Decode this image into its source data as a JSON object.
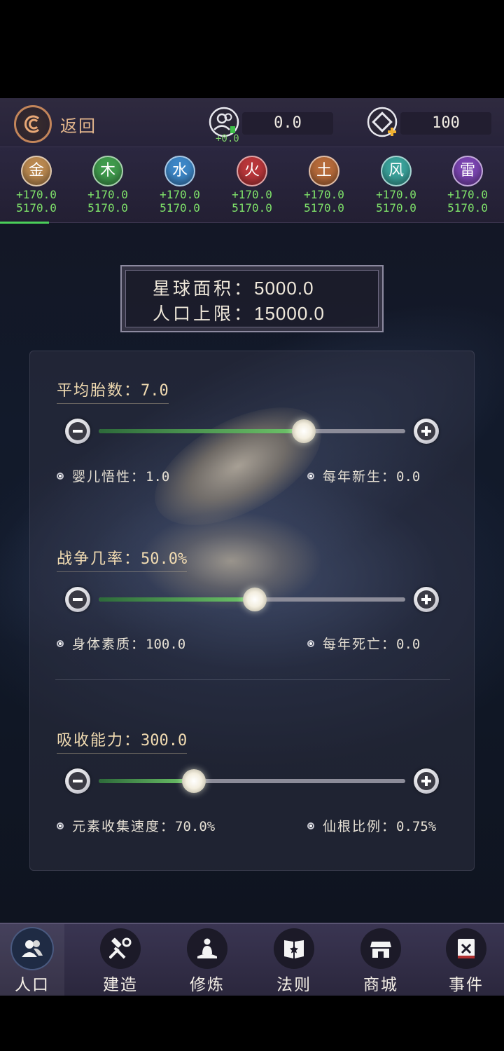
{
  "header": {
    "back_label": "返回",
    "population": {
      "value": "0.0",
      "delta": "+0.0",
      "icon": "population-icon"
    },
    "currency": {
      "value": "100",
      "icon": "spirit-stone-add-icon"
    }
  },
  "elements": [
    {
      "name": "金",
      "rate": "+170.0",
      "total": "5170.0",
      "color": "#b98850"
    },
    {
      "name": "木",
      "rate": "+170.0",
      "total": "5170.0",
      "color": "#3f9a4c"
    },
    {
      "name": "水",
      "rate": "+170.0",
      "total": "5170.0",
      "color": "#3d86c6"
    },
    {
      "name": "火",
      "rate": "+170.0",
      "total": "5170.0",
      "color": "#b8363a"
    },
    {
      "name": "土",
      "rate": "+170.0",
      "total": "5170.0",
      "color": "#b56a3a"
    },
    {
      "name": "风",
      "rate": "+170.0",
      "total": "5170.0",
      "color": "#3aa19a"
    },
    {
      "name": "雷",
      "rate": "+170.0",
      "total": "5170.0",
      "color": "#7a44b0"
    }
  ],
  "planet": {
    "area_label": "星球面积：",
    "area_value": "5000.0",
    "pop_limit_label": "人口上限：",
    "pop_limit_value": "15000.0"
  },
  "sliders": [
    {
      "title": "平均胎数：",
      "value": "7.0",
      "fraction": 0.67,
      "stat_left_label": "婴儿悟性：",
      "stat_left_value": "1.0",
      "stat_right_label": "每年新生：",
      "stat_right_value": "0.0"
    },
    {
      "title": "战争几率：",
      "value": "50.0%",
      "fraction": 0.51,
      "stat_left_label": "身体素质：",
      "stat_left_value": "100.0",
      "stat_right_label": "每年死亡：",
      "stat_right_value": "0.0"
    },
    {
      "title": "吸收能力：",
      "value": "300.0",
      "fraction": 0.31,
      "stat_left_label": "元素收集速度：",
      "stat_left_value": "70.0%",
      "stat_right_label": "仙根比例：",
      "stat_right_value": "0.75%"
    }
  ],
  "nav": [
    {
      "label": "人口",
      "icon": "population-icon",
      "active": true
    },
    {
      "label": "建造",
      "icon": "hammer-wrench-icon",
      "active": false
    },
    {
      "label": "修炼",
      "icon": "meditation-icon",
      "active": false
    },
    {
      "label": "法则",
      "icon": "law-book-icon",
      "active": false
    },
    {
      "label": "商城",
      "icon": "shop-icon",
      "active": false
    },
    {
      "label": "事件",
      "icon": "event-scroll-icon",
      "active": false
    }
  ]
}
